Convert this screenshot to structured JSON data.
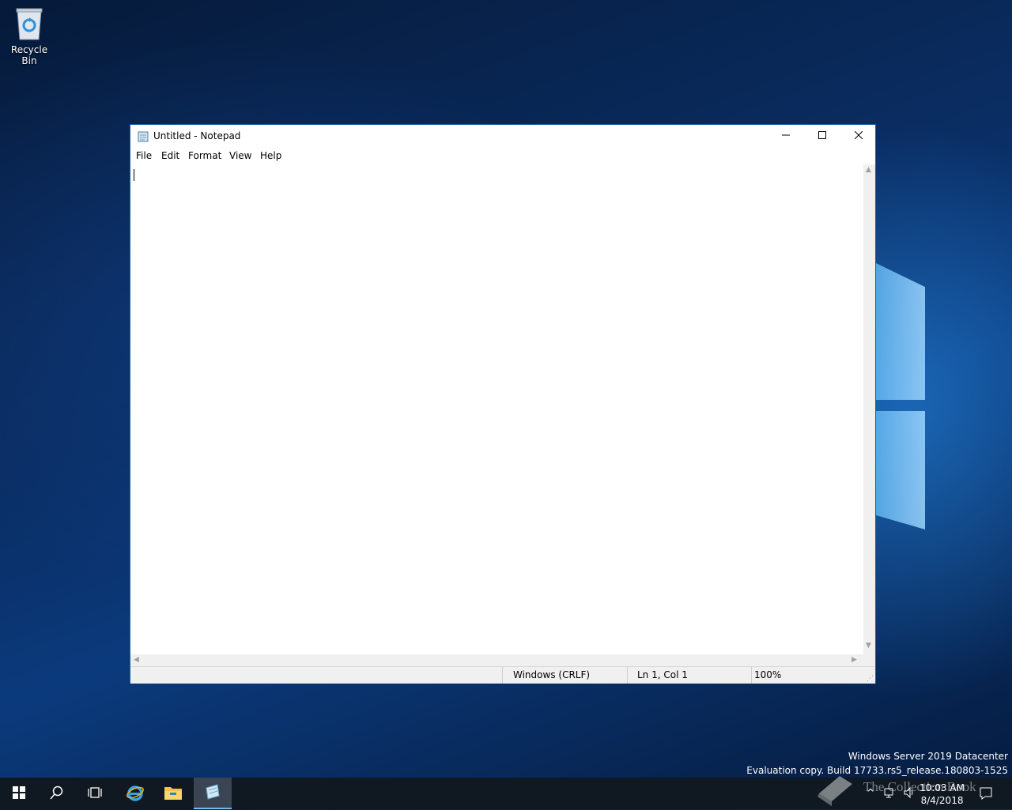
{
  "desktop": {
    "icons": [
      {
        "label": "Recycle Bin",
        "icon": "recycle-bin-icon"
      }
    ],
    "watermark": {
      "line1": "Windows Server 2019 Datacenter",
      "line2": "Evaluation copy. Build 17733.rs5_release.180803-1525"
    },
    "overlay_brand": "The Collection Book"
  },
  "notepad": {
    "title": "Untitled - Notepad",
    "menu": [
      "File",
      "Edit",
      "Format",
      "View",
      "Help"
    ],
    "content": "",
    "status": {
      "line_ending": "Windows (CRLF)",
      "position": "Ln 1, Col 1",
      "zoom": "100%"
    }
  },
  "taskbar": {
    "items": [
      "start-icon",
      "search-icon",
      "task-view-icon",
      "internet-explorer-icon",
      "file-explorer-icon",
      "notepad-icon"
    ],
    "active": "notepad-icon",
    "clock": {
      "time": "10:03 AM",
      "date": "8/4/2018"
    }
  },
  "colors": {
    "accent": "#76b9ed",
    "taskbar": "#101822",
    "title_border": "#1f5fa8"
  }
}
